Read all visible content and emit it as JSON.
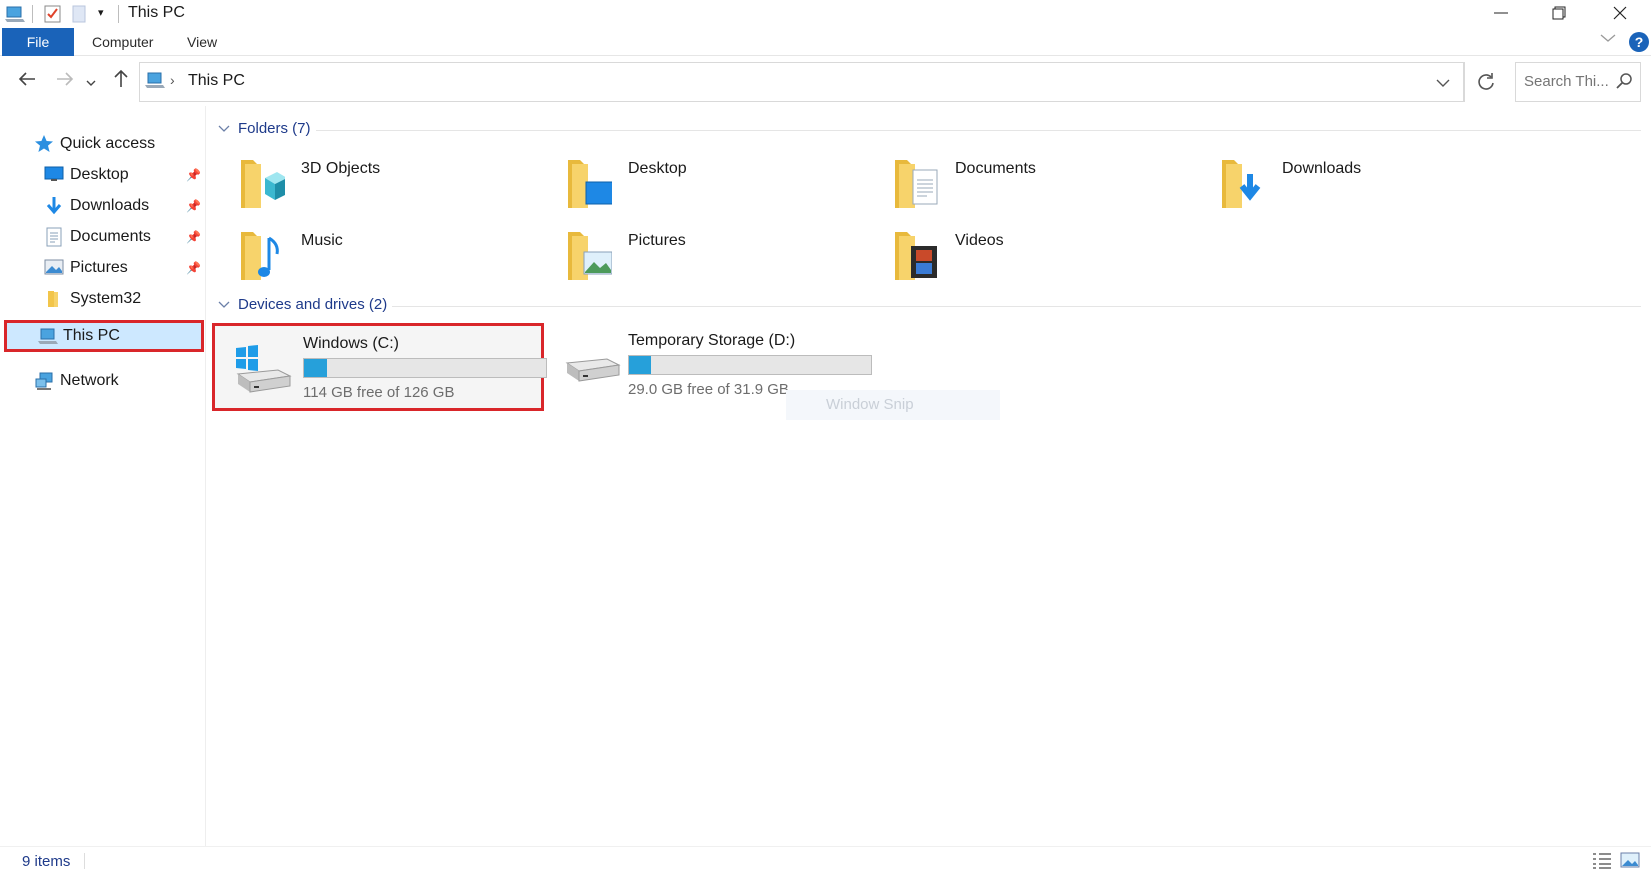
{
  "window": {
    "title": "This PC"
  },
  "ribbon": {
    "tabs": [
      "File",
      "Computer",
      "View"
    ],
    "help": "?"
  },
  "navigation": {
    "address": "This PC",
    "search_placeholder": "Search Thi..."
  },
  "sidebar": {
    "quick_access": "Quick access",
    "items": [
      {
        "label": "Desktop",
        "icon": "desktop-icon",
        "pinned": true
      },
      {
        "label": "Downloads",
        "icon": "downloads-icon",
        "pinned": true
      },
      {
        "label": "Documents",
        "icon": "documents-icon",
        "pinned": true
      },
      {
        "label": "Pictures",
        "icon": "pictures-icon",
        "pinned": true
      },
      {
        "label": "System32",
        "icon": "folder-icon",
        "pinned": false
      }
    ],
    "this_pc": "This PC",
    "network": "Network"
  },
  "content": {
    "folders_header": "Folders (7)",
    "folders": [
      {
        "label": "3D Objects",
        "icon": "3d-objects-icon"
      },
      {
        "label": "Desktop",
        "icon": "desktop-folder-icon"
      },
      {
        "label": "Documents",
        "icon": "documents-folder-icon"
      },
      {
        "label": "Downloads",
        "icon": "downloads-folder-icon"
      },
      {
        "label": "Music",
        "icon": "music-folder-icon"
      },
      {
        "label": "Pictures",
        "icon": "pictures-folder-icon"
      },
      {
        "label": "Videos",
        "icon": "videos-folder-icon"
      }
    ],
    "drives_header": "Devices and drives (2)",
    "drives": [
      {
        "name": "Windows (C:)",
        "free": "114 GB free of 126 GB",
        "used_fraction": 0.095
      },
      {
        "name": "Temporary Storage (D:)",
        "free": "29.0 GB free of 31.9 GB",
        "used_fraction": 0.091
      }
    ],
    "snip_overlay": "Window Snip"
  },
  "status": {
    "item_count": "9 items"
  },
  "colors": {
    "accent": "#1a63b9",
    "highlight": "#d9262a",
    "bar_fill": "#26a0da",
    "folder": "#f7d36b"
  }
}
